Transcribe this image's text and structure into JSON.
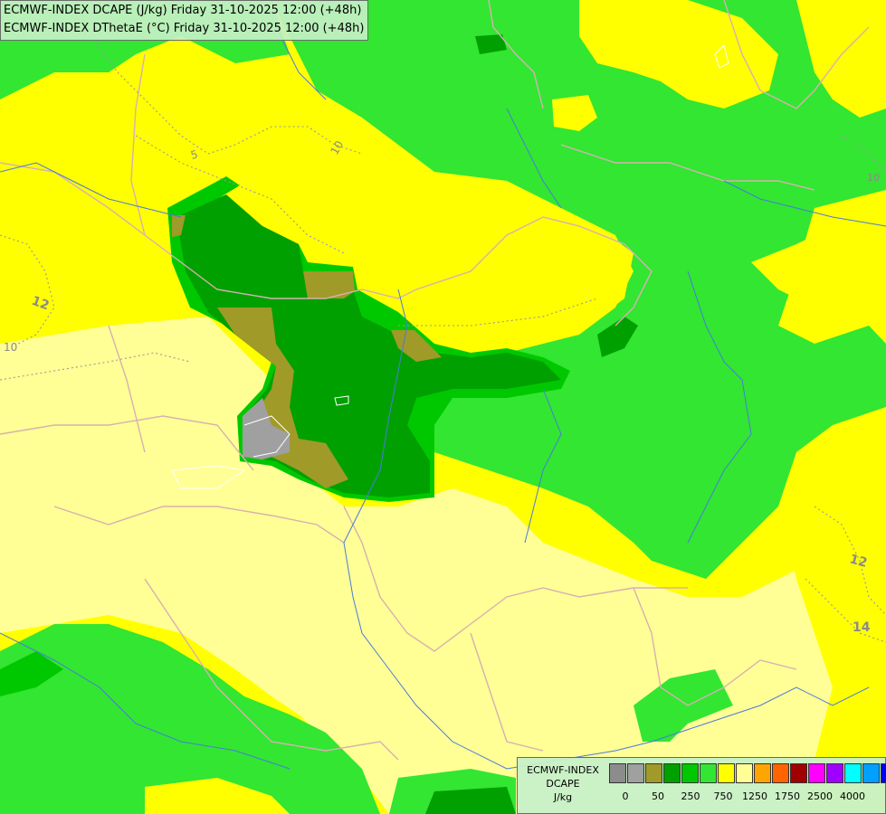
{
  "header": {
    "line1": "ECMWF-INDEX DCAPE (J/kg) Friday 31-10-2025 12:00 (+48h)",
    "line2": "ECMWF-INDEX DThetaE (°C) Friday 31-10-2025 12:00 (+48h)"
  },
  "legend": {
    "model": "ECMWF-INDEX",
    "parameter": "DCAPE",
    "unit": "J/kg",
    "colors": [
      "#8c8c8c",
      "#a0a0a0",
      "#a09a28",
      "#00a000",
      "#00c800",
      "#32e632",
      "#ffff00",
      "#ffff96",
      "#ffa500",
      "#ff6400",
      "#a00000",
      "#ff00ff",
      "#a000ff",
      "#00ffff",
      "#00a0ff",
      "#0000ff",
      "#000080"
    ],
    "tick_labels": [
      "0",
      "50",
      "250",
      "750",
      "1250",
      "1750",
      "2500",
      "4000"
    ]
  },
  "map_labels": {
    "contour_5": "5",
    "contour_10_top": "10",
    "contour_12_left": "12",
    "contour_10_left": "10",
    "contour_12_right": "12",
    "contour_14_right": "14",
    "contour_10_right": "10"
  }
}
